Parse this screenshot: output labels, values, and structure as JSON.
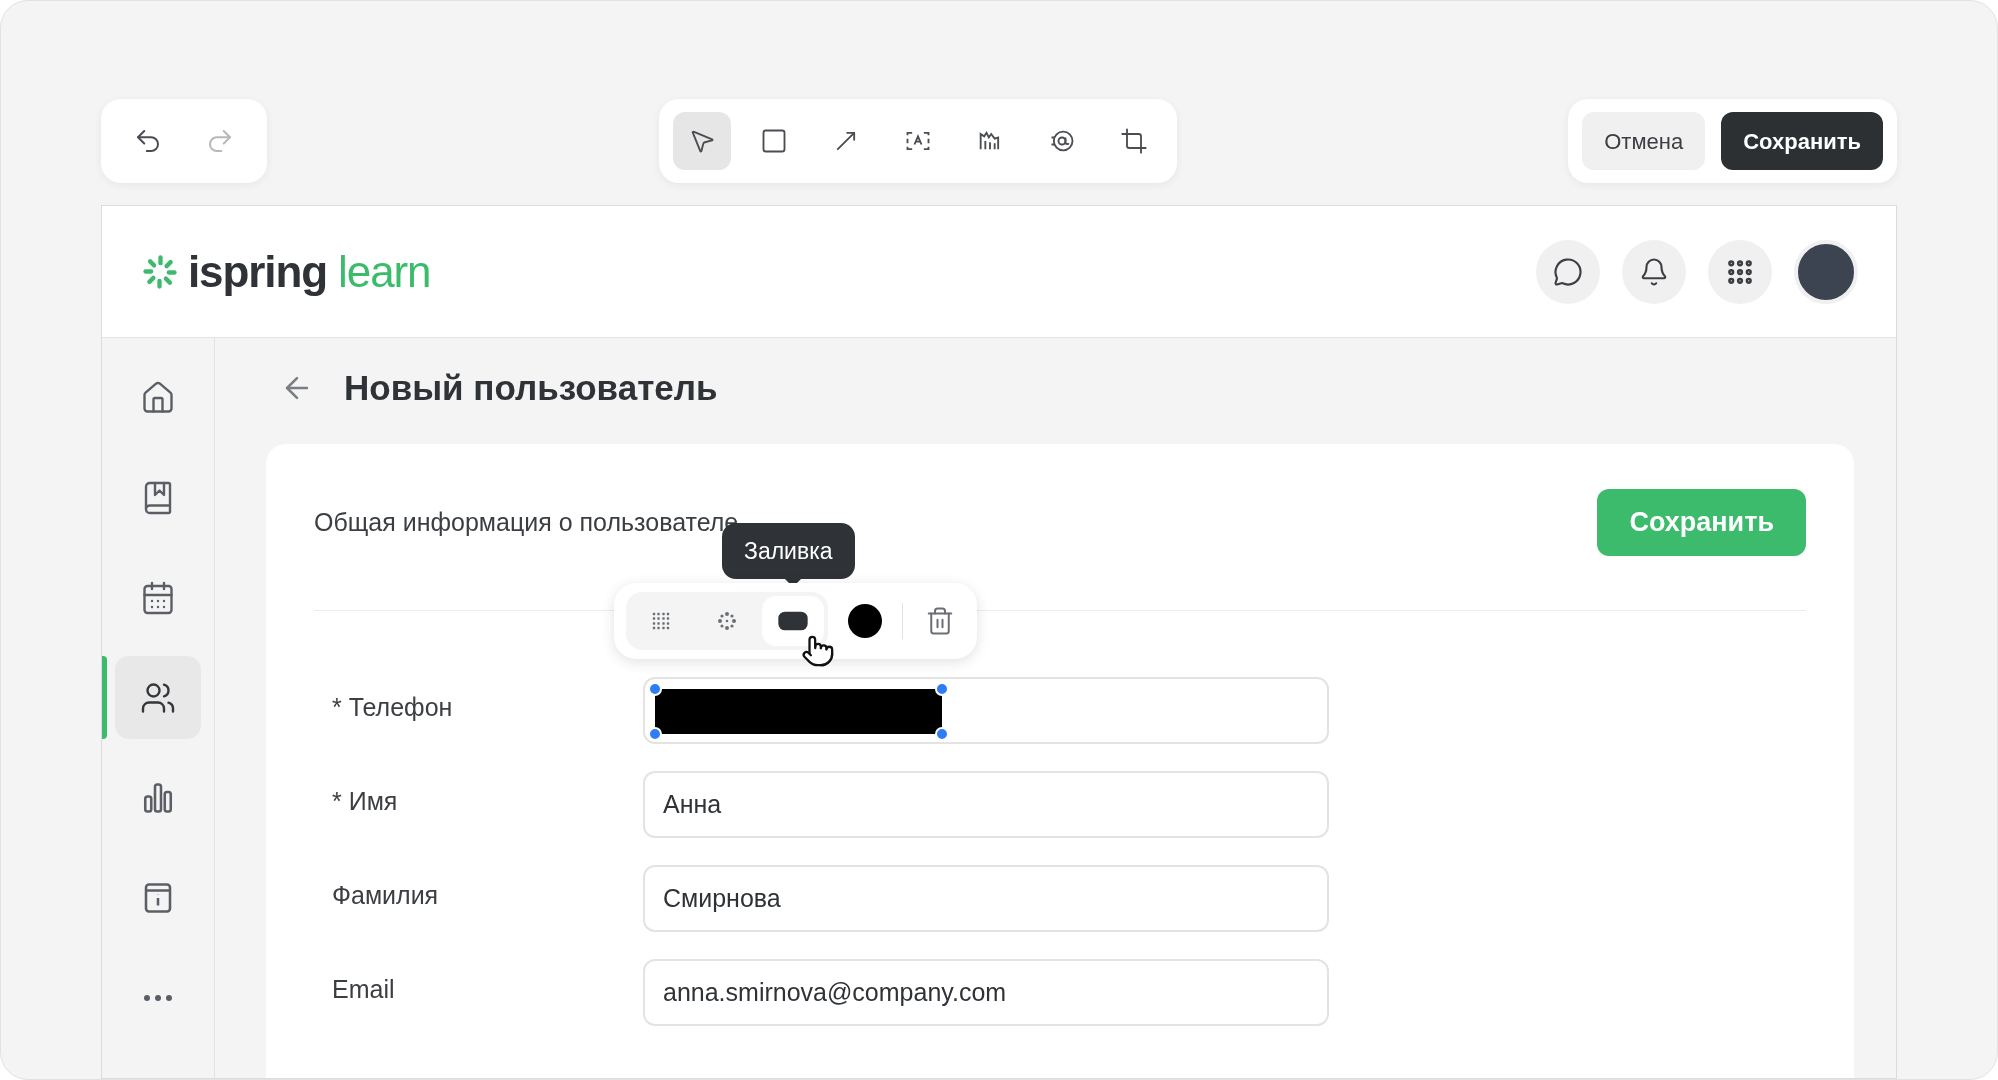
{
  "editor_toolbar": {
    "history": [
      {
        "kind": "undo",
        "disabled": false
      },
      {
        "kind": "redo",
        "disabled": true
      }
    ],
    "tools": [
      {
        "kind": "select",
        "selected": true
      },
      {
        "kind": "rectangle",
        "selected": false
      },
      {
        "kind": "arrow",
        "selected": false
      },
      {
        "kind": "text",
        "selected": false
      },
      {
        "kind": "marker",
        "selected": false
      },
      {
        "kind": "redact",
        "selected": false
      },
      {
        "kind": "crop",
        "selected": false
      }
    ],
    "buttons": [
      {
        "label": "Отмена",
        "kind": "secondary"
      },
      {
        "label": "Сохранить",
        "kind": "primary"
      }
    ]
  },
  "app": {
    "logo": {
      "brand": "ispring",
      "product": "learn"
    },
    "header_actions": [
      {
        "kind": "chat"
      },
      {
        "kind": "notifications"
      },
      {
        "kind": "apps"
      },
      {
        "kind": "avatar"
      }
    ],
    "sidebar": {
      "items": [
        {
          "kind": "home",
          "selected": false
        },
        {
          "kind": "courses",
          "selected": false
        },
        {
          "kind": "calendar",
          "selected": false
        },
        {
          "kind": "users",
          "selected": true
        },
        {
          "kind": "reports",
          "selected": false
        },
        {
          "kind": "info",
          "selected": false
        },
        {
          "kind": "more",
          "selected": false
        }
      ]
    },
    "page_title": "Новый пользователь",
    "section_title": "Общая информация о пользователе",
    "save_button": "Сохранить",
    "fields": [
      {
        "label": "* Телефон",
        "redacted": true
      },
      {
        "label": "* Имя",
        "value": "Анна",
        "redacted": false
      },
      {
        "label": "Фамилия",
        "value": "Смирнова",
        "redacted": false
      },
      {
        "label": "Email",
        "value": "anna.smirnova@company.com",
        "redacted": false
      }
    ]
  },
  "redaction_toolbar": {
    "tooltip": "Заливка",
    "modes": [
      {
        "kind": "pixelate",
        "selected": false
      },
      {
        "kind": "blur",
        "selected": false
      },
      {
        "kind": "fill",
        "selected": true
      }
    ],
    "color": "#000000"
  }
}
